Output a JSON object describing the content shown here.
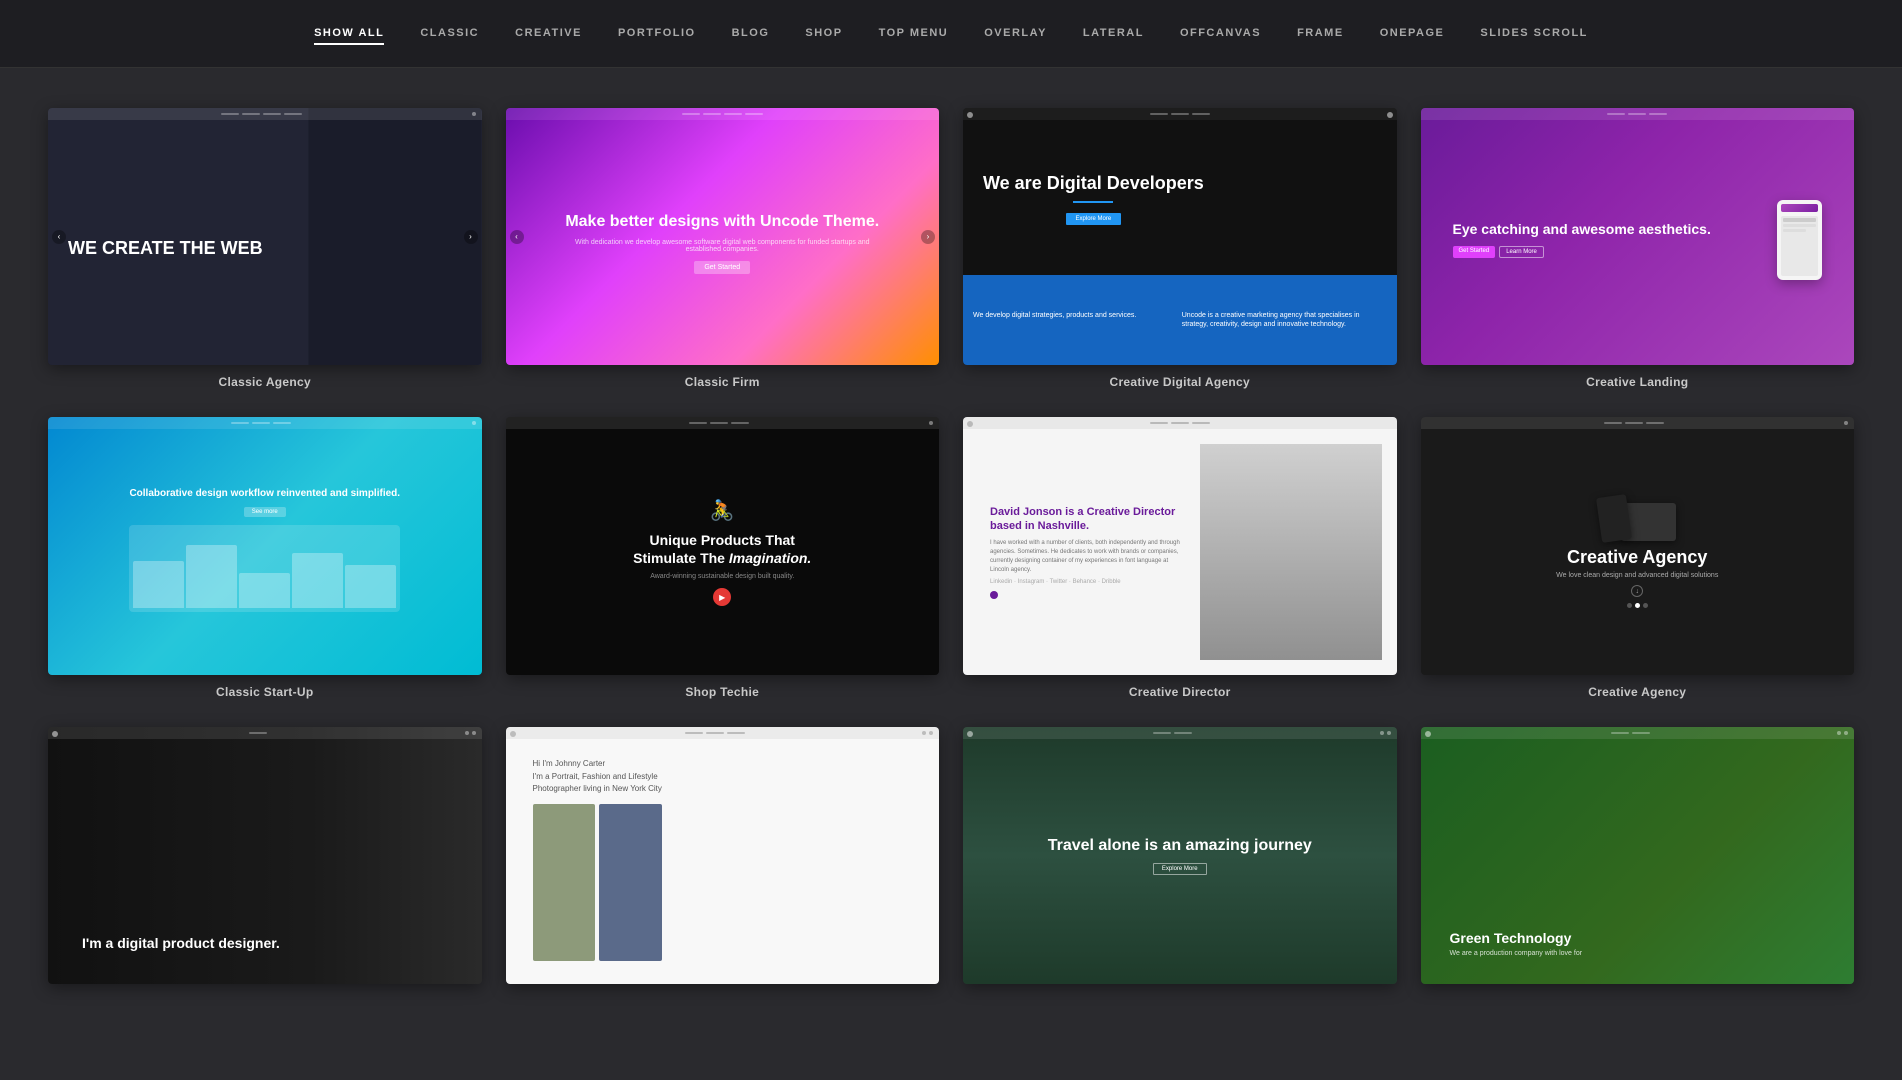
{
  "nav": {
    "items": [
      {
        "label": "SHOW ALL",
        "active": true
      },
      {
        "label": "CLASSIC",
        "active": false
      },
      {
        "label": "CREATIVE",
        "active": false
      },
      {
        "label": "PORTFOLIO",
        "active": false
      },
      {
        "label": "BLOG",
        "active": false
      },
      {
        "label": "SHOP",
        "active": false
      },
      {
        "label": "TOP MENU",
        "active": false
      },
      {
        "label": "OVERLAY",
        "active": false
      },
      {
        "label": "LATERAL",
        "active": false
      },
      {
        "label": "OFFCANVAS",
        "active": false
      },
      {
        "label": "FRAME",
        "active": false
      },
      {
        "label": "ONEPAGE",
        "active": false
      },
      {
        "label": "SLIDES SCROLL",
        "active": false
      }
    ]
  },
  "cards": [
    {
      "id": 1,
      "label": "Classic Agency",
      "main_text": "WE CREATE THE WEB",
      "sub_text": ""
    },
    {
      "id": 2,
      "label": "Classic Firm",
      "main_text": "Make better designs with Uncode Theme.",
      "sub_text": "Get Started"
    },
    {
      "id": 3,
      "label": "Creative Digital Agency",
      "main_text": "We are Digital Developers",
      "sub_text": "We develop digital strategies, products and services."
    },
    {
      "id": 4,
      "label": "Creative Landing",
      "main_text": "Eye catching and awesome aesthetics.",
      "sub_text": ""
    },
    {
      "id": 5,
      "label": "Classic Start-Up",
      "main_text": "Collaborative design workflow reinvented and simplified.",
      "sub_text": "See more"
    },
    {
      "id": 6,
      "label": "Shop Techie",
      "main_text": "Unique Products That Stimulate The Imagination.",
      "sub_text": "Award-winning sustainable design built quality."
    },
    {
      "id": 7,
      "label": "Creative Director",
      "main_text": "David Jonson is a Creative Director based in Nashville.",
      "sub_text": ""
    },
    {
      "id": 8,
      "label": "Creative Agency",
      "main_text": "Creative Agency",
      "sub_text": "We love clean design and advanced digital solutions"
    },
    {
      "id": 9,
      "label": "",
      "main_text": "I'm a digital product designer.",
      "sub_text": ""
    },
    {
      "id": 10,
      "label": "",
      "main_text": "Hi I'm Johnny Carter\nI'm a Portrait, Fashion and Lifestyle\nPhotographer living in New York City",
      "sub_text": ""
    },
    {
      "id": 11,
      "label": "",
      "main_text": "Travel alone is an amazing journey",
      "sub_text": ""
    },
    {
      "id": 12,
      "label": "",
      "main_text": "Green Technology",
      "sub_text": "We are a production company with love for"
    }
  ]
}
